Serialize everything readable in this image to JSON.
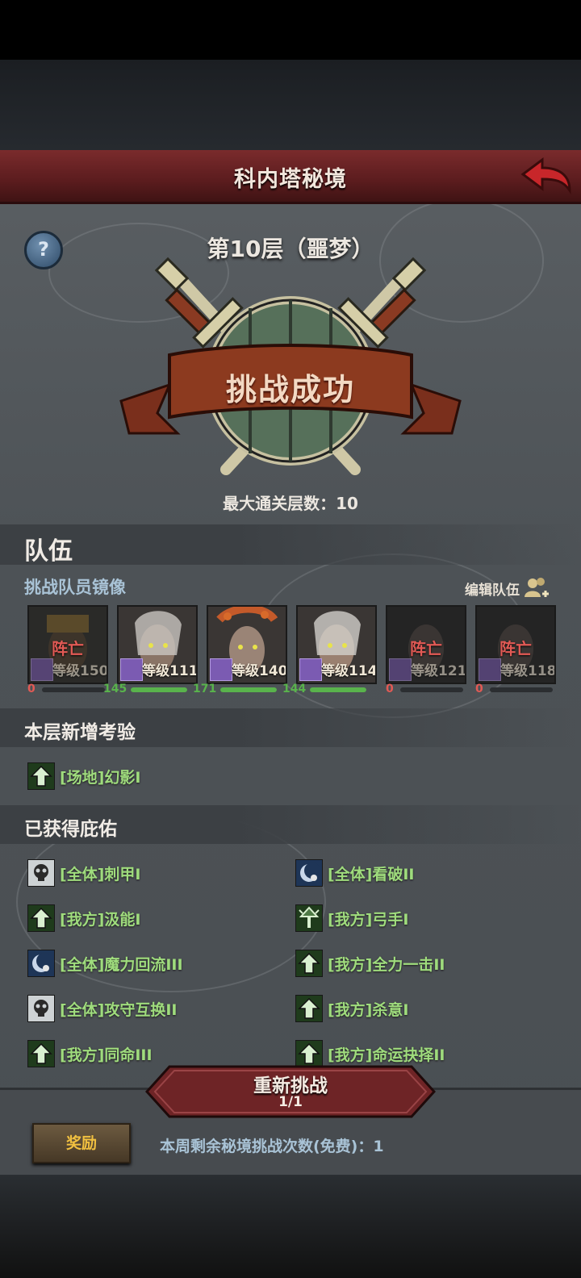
{
  "header": {
    "title": "科内塔秘境"
  },
  "floor": {
    "title": "第10层（噩梦）",
    "result": "挑战成功",
    "max_floor": "最大通关层数：10"
  },
  "team": {
    "section_title": "队伍",
    "subtitle": "挑战队员镜像",
    "edit_label": "编辑队伍",
    "members": [
      {
        "status": "阵亡",
        "level": "等级150",
        "hp": "0",
        "hp_fill": 0
      },
      {
        "status": "",
        "level": "等级111",
        "hp": "145",
        "hp_fill": 1
      },
      {
        "status": "",
        "level": "等级140",
        "hp": "171",
        "hp_fill": 1
      },
      {
        "status": "",
        "level": "等级114",
        "hp": "144",
        "hp_fill": 1
      },
      {
        "status": "阵亡",
        "level": "等级121",
        "hp": "0",
        "hp_fill": 0
      },
      {
        "status": "阵亡",
        "level": "等级118",
        "hp": "0",
        "hp_fill": 0
      }
    ]
  },
  "trials": {
    "section_title": "本层新增考验",
    "items": [
      {
        "label": "[场地]幻影I",
        "icon": "arrow-up-icon"
      }
    ]
  },
  "blessings": {
    "section_title": "已获得庇佑",
    "left": [
      {
        "label": "[全体]刺甲I",
        "icon": "skull-icon"
      },
      {
        "label": "[我方]汲能I",
        "icon": "arrow-up-icon"
      },
      {
        "label": "[全体]魔力回流III",
        "icon": "moon-icon"
      },
      {
        "label": "[全体]攻守互换II",
        "icon": "skull-icon"
      },
      {
        "label": "[我方]同命III",
        "icon": "arrow-up-icon"
      }
    ],
    "right": [
      {
        "label": "[全体]看破II",
        "icon": "moon-icon"
      },
      {
        "label": "[我方]弓手I",
        "icon": "tree-icon"
      },
      {
        "label": "[我方]全力一击II",
        "icon": "arrow-up-icon"
      },
      {
        "label": "[我方]杀意I",
        "icon": "arrow-up-icon"
      },
      {
        "label": "[我方]命运抉择II",
        "icon": "arrow-up-icon"
      }
    ]
  },
  "footer": {
    "retry_label": "重新挑战",
    "retry_count": "1/1",
    "reward_label": "奖励",
    "weekly_remaining": "本周剩余秘境挑战次数(免费)：1"
  },
  "colors": {
    "header": "#6b2426",
    "buff_text": "#9fdc7d",
    "hp_green": "#59b34c",
    "dead_red": "#e25a55",
    "accent_blue": "#a9c3d6"
  }
}
